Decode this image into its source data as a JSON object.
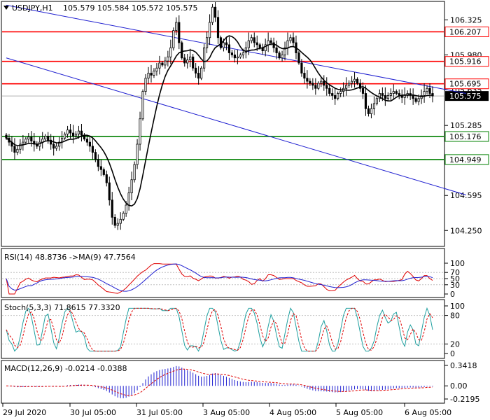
{
  "chart_data": {
    "type": "candlestick",
    "title": "USDJPY,H1",
    "ohlc_header": [
      "105.579",
      "105.584",
      "105.572",
      "105.575"
    ],
    "price_axis": {
      "ylim": [
        104.1,
        106.5
      ],
      "ticks": [
        106.325,
        105.98,
        105.635,
        105.285,
        104.94,
        104.595,
        104.25
      ]
    },
    "x_axis_labels": [
      "29 Jul 2020",
      "30 Jul 05:00",
      "31 Jul 05:00",
      "3 Aug 05:00",
      "4 Aug 05:00",
      "5 Aug 05:00",
      "6 Aug 05:00"
    ],
    "horizontal_levels": [
      {
        "price": 106.207,
        "label": "106.207",
        "color": "#ff0000"
      },
      {
        "price": 105.916,
        "label": "105.916",
        "color": "#ff0000"
      },
      {
        "price": 105.695,
        "label": "105.695",
        "color": "#ff0000"
      },
      {
        "price": 105.176,
        "label": "105.176",
        "color": "#008000"
      },
      {
        "price": 104.949,
        "label": "104.949",
        "color": "#008000"
      }
    ],
    "current_price": {
      "price": 105.575,
      "label": "105.575"
    },
    "trend_channel": [
      {
        "p1": [
          0,
          106.47
        ],
        "p2": [
          165,
          105.6
        ]
      },
      {
        "p1": [
          0,
          105.95
        ],
        "p2": [
          165,
          104.6
        ]
      }
    ],
    "closes": [
      105.16,
      105.12,
      105.08,
      105.02,
      105.05,
      105.1,
      105.12,
      105.15,
      105.17,
      105.13,
      105.1,
      105.08,
      105.12,
      105.15,
      105.18,
      105.14,
      105.1,
      105.06,
      105.08,
      105.12,
      105.16,
      105.2,
      105.24,
      105.21,
      105.18,
      105.2,
      105.23,
      105.19,
      105.15,
      105.12,
      105.08,
      105.02,
      104.95,
      104.88,
      104.85,
      104.8,
      104.72,
      104.55,
      104.38,
      104.3,
      104.32,
      104.36,
      104.42,
      104.5,
      104.62,
      104.75,
      104.9,
      105.1,
      105.35,
      105.62,
      105.75,
      105.8,
      105.78,
      105.82,
      105.85,
      105.9,
      105.88,
      105.92,
      105.96,
      106.05,
      106.22,
      106.3,
      106.1,
      105.95,
      105.9,
      105.93,
      105.96,
      105.85,
      105.8,
      105.75,
      105.85,
      106.05,
      106.15,
      106.3,
      106.45,
      106.35,
      106.15,
      106.05,
      106.1,
      106.08,
      106.0,
      105.98,
      105.95,
      105.96,
      105.98,
      106.0,
      106.05,
      106.12,
      106.15,
      106.1,
      106.08,
      106.05,
      106.02,
      106.08,
      106.12,
      106.1,
      106.05,
      106.0,
      105.95,
      105.98,
      106.05,
      106.12,
      106.15,
      106.1,
      106.0,
      105.9,
      105.8,
      105.75,
      105.72,
      105.7,
      105.68,
      105.65,
      105.7,
      105.72,
      105.68,
      105.65,
      105.6,
      105.58,
      105.55,
      105.6,
      105.62,
      105.65,
      105.68,
      105.7,
      105.72,
      105.74,
      105.7,
      105.65,
      105.6,
      105.45,
      105.4,
      105.45,
      105.5,
      105.55,
      105.6,
      105.58,
      105.55,
      105.58,
      105.6,
      105.62,
      105.6,
      105.58,
      105.56,
      105.58,
      105.6,
      105.58,
      105.55,
      105.52,
      105.55,
      105.58,
      105.62,
      105.65,
      105.6,
      105.575
    ],
    "ma_dates": "smoothed moving average overlay",
    "rsi": {
      "label": "RSI(14) 48.8736  ->MA(9) 47.7564",
      "ticks": [
        100,
        70,
        50,
        30,
        0
      ],
      "levels": [
        70,
        50,
        30
      ]
    },
    "stoch": {
      "label": "Stoch(5,3,3) 71.8615 77.3320",
      "ticks": [
        100,
        80,
        20,
        0
      ],
      "levels": [
        80,
        20
      ]
    },
    "macd": {
      "label": "MACD(12,26,9) -0.0214 -0.0388",
      "ticks": [
        "0.3418",
        "0.00",
        "-0.2195"
      ],
      "range": [
        -0.2195,
        0.3418
      ]
    }
  }
}
